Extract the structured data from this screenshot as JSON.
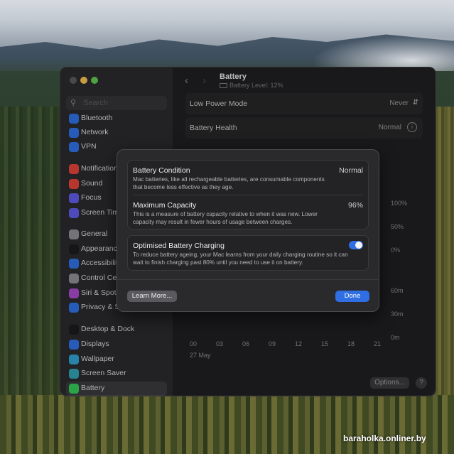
{
  "sidebar": {
    "search_placeholder": "Search",
    "items": [
      {
        "label": "Bluetooth",
        "icon": "bluetooth-icon",
        "color": "#2f6fe3"
      },
      {
        "label": "Network",
        "icon": "globe-icon",
        "color": "#2f6fe3"
      },
      {
        "label": "VPN",
        "icon": "vpn-icon",
        "color": "#2f6fe3"
      },
      {
        "label": "Notifications",
        "icon": "bell-icon",
        "color": "#e0443a"
      },
      {
        "label": "Sound",
        "icon": "speaker-icon",
        "color": "#e0443a"
      },
      {
        "label": "Focus",
        "icon": "moon-icon",
        "color": "#5e5ce6"
      },
      {
        "label": "Screen Time",
        "icon": "hourglass-icon",
        "color": "#5e5ce6"
      },
      {
        "label": "General",
        "icon": "gear-icon",
        "color": "#8e8e93"
      },
      {
        "label": "Appearance",
        "icon": "appearance-icon",
        "color": "#1c1c1e"
      },
      {
        "label": "Accessibility",
        "icon": "accessibility-icon",
        "color": "#2f6fe3"
      },
      {
        "label": "Control Centre",
        "icon": "control-centre-icon",
        "color": "#8e8e93"
      },
      {
        "label": "Siri & Spotlight",
        "icon": "siri-icon",
        "color": "#a64ac9"
      },
      {
        "label": "Privacy & Security",
        "icon": "hand-icon",
        "color": "#2f6fe3"
      },
      {
        "label": "Desktop & Dock",
        "icon": "dock-icon",
        "color": "#1c1c1e"
      },
      {
        "label": "Displays",
        "icon": "display-icon",
        "color": "#2f6fe3"
      },
      {
        "label": "Wallpaper",
        "icon": "wallpaper-icon",
        "color": "#30a0d0"
      },
      {
        "label": "Screen Saver",
        "icon": "screensaver-icon",
        "color": "#30a0b0"
      },
      {
        "label": "Battery",
        "icon": "battery-icon",
        "color": "#34c759"
      }
    ]
  },
  "main": {
    "title": "Battery",
    "subtitle": "Battery Level: 12%",
    "low_power_label": "Low Power Mode",
    "low_power_value": "Never",
    "health_label": "Battery Health",
    "health_value": "Normal",
    "pct_labels": [
      "100%",
      "50%",
      "0%"
    ],
    "time_labels": [
      "60m",
      "30m",
      "0m"
    ],
    "x_ticks": [
      "00",
      "03",
      "06",
      "09",
      "12",
      "15",
      "18",
      "21"
    ],
    "x_date": "27 May",
    "options_label": "Options...",
    "help_label": "?"
  },
  "sheet": {
    "condition_title": "Battery Condition",
    "condition_value": "Normal",
    "condition_desc": "Mac batteries, like all rechargeable batteries, are consumable components that become less effective as they age.",
    "capacity_title": "Maximum Capacity",
    "capacity_value": "96%",
    "capacity_desc": "This is a measure of battery capacity relative to when it was new. Lower capacity may result in fewer hours of usage between charges.",
    "optimised_title": "Optimised Battery Charging",
    "optimised_desc": "To reduce battery ageing, your Mac learns from your daily charging routine so it can wait to finish charging past 80% until you need to use it on battery.",
    "optimised_on": true,
    "learn_more": "Learn More...",
    "done": "Done"
  },
  "watermark": "baraholka.onliner.by"
}
